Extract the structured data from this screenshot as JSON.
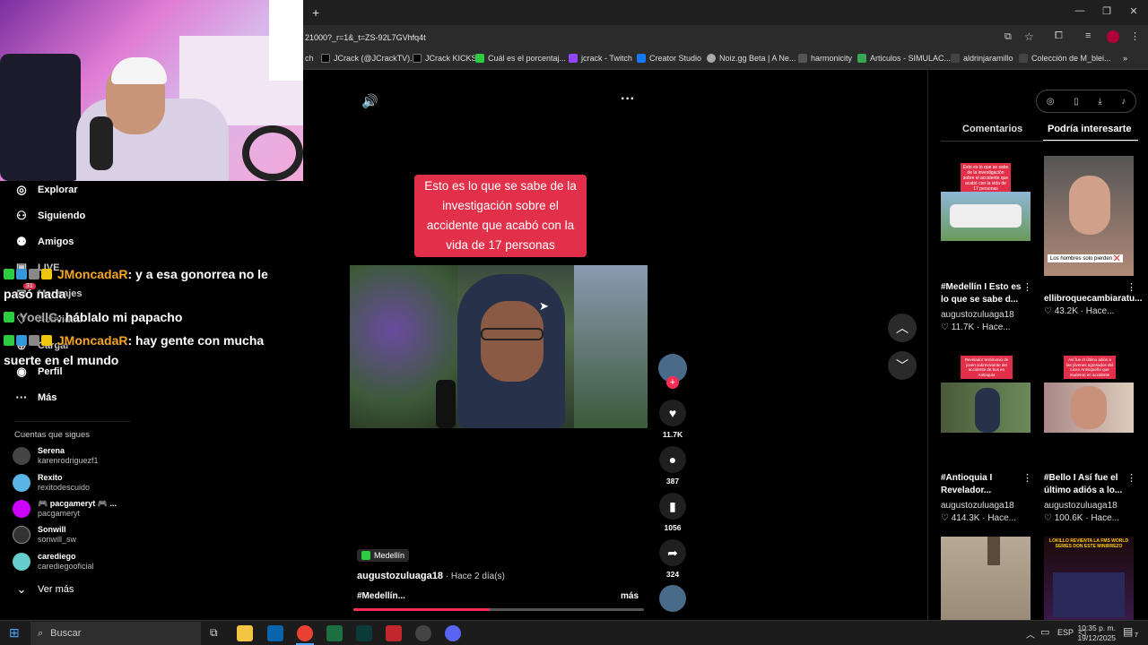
{
  "browser": {
    "new_tab": "+",
    "url": "21000?_r=1&_t=ZS-92L7GVhfq4t",
    "bookmarks": [
      {
        "label": "ch",
        "color": "#888"
      },
      {
        "label": "JCrack (@JCrackTV)...",
        "color": "#000"
      },
      {
        "label": "JCrack KICKS",
        "color": "#000"
      },
      {
        "label": "Cuál es el porcentaj...",
        "color": "#2ecc40"
      },
      {
        "label": "jcrack - Twitch",
        "color": "#9146ff"
      },
      {
        "label": "Creator Studio",
        "color": "#1877f2"
      },
      {
        "label": "Noiz.gg Beta | A Ne...",
        "color": "#aaa"
      },
      {
        "label": "harmonicity",
        "color": "#555"
      },
      {
        "label": "Articulos - SIMULAC...",
        "color": "#34a853"
      },
      {
        "label": "aldrinjaramillo",
        "color": "#444"
      },
      {
        "label": "Colección de M_blei...",
        "color": "#444"
      }
    ],
    "more_bookmarks": "»"
  },
  "sidebar": {
    "nav": [
      {
        "label": "Explorar",
        "icon": "compass-icon",
        "glyph": "◎"
      },
      {
        "label": "Siguiendo",
        "icon": "following-icon",
        "glyph": "⚇"
      },
      {
        "label": "Amigos",
        "icon": "friends-icon",
        "glyph": "⚉"
      },
      {
        "label": "LIVE",
        "icon": "live-icon",
        "glyph": "▣"
      },
      {
        "label": "Mensajes",
        "icon": "messages-icon",
        "glyph": "✉"
      },
      {
        "label": "Actividad",
        "icon": "activity-icon",
        "glyph": "♡"
      },
      {
        "label": "Cargar",
        "icon": "upload-icon",
        "glyph": "⊕"
      },
      {
        "label": "Perfil",
        "icon": "profile-icon",
        "glyph": "◉"
      },
      {
        "label": "Más",
        "icon": "more-icon",
        "glyph": "···"
      }
    ],
    "messages_badge": "31",
    "following_title": "Cuentas que sigues",
    "accounts": [
      {
        "name": "Serena",
        "handle": "karenrodriguezf1",
        "color": "#444"
      },
      {
        "name": "Rexito",
        "handle": "rexitodescuido",
        "color": "#5ab4e5"
      },
      {
        "name": "🎮 pacgameryt 🎮 ...",
        "handle": "pacgameryt",
        "color": "#c0f"
      },
      {
        "name": "Sonwill",
        "handle": "sonwill_sw",
        "color": "#333"
      },
      {
        "name": "carediego",
        "handle": "carediegooficial",
        "color": "#6cc"
      }
    ],
    "see_more": "Ver más"
  },
  "chat": [
    {
      "user": "JMoncadaR",
      "text": ": y a esa gonorrea no le pasó nada"
    },
    {
      "user": "YoellC",
      "text": ": háblalo mi papacho"
    },
    {
      "user": "JMoncadaR",
      "text": ": hay gente con mucha suerte en el mundo"
    }
  ],
  "player": {
    "overlay_text": "Esto es lo que se sabe de la investigación sobre el accidente que acabó con la vida de 17 personas",
    "likes": "11.7K",
    "comments": "387",
    "saves": "1056",
    "shares": "324",
    "location_tag": "Medellín",
    "author": "augustozuluaga18",
    "time": "Hace 2 día(s)",
    "caption": "#Medellín...",
    "more": "más",
    "progress": 0.47
  },
  "right_panel": {
    "tabs": [
      "Comentarios",
      "Podría interesarte"
    ],
    "active_tab": 1,
    "cards": [
      {
        "title": "#Medellín I Esto es lo que se sabe d...",
        "author": "augustozuluaga18",
        "stats": "11.7K · Hace...",
        "thumb_text": "Esto es lo que se sabe de la investigación sobre el accidente que acabó con la vida de 17 personas"
      },
      {
        "title": "ellibroquecambiaratu...",
        "author": "",
        "stats": "43.2K · Hace...",
        "thumb_text": "Los hombres solo pierden ❌"
      },
      {
        "title": "#Antioquia I Revelador...",
        "author": "augustozuluaga18",
        "stats": "414.3K · Hace...",
        "thumb_text": "Revelador testimonio de joven sobreviviente del accidente de bus en Antioquia"
      },
      {
        "title": "#Bello I Así fue el último adiós a lo...",
        "author": "augustozuluaga18",
        "stats": "100.6K · Hace...",
        "thumb_text": "Así fue el último adiós a las jóvenes egresados del Liceo Antioqueño que murieron en accidente"
      },
      {
        "title": "",
        "author": "",
        "stats": "",
        "thumb_text": ""
      },
      {
        "title": "",
        "author": "",
        "stats": "",
        "thumb_text": "LOKILLO REVIENTA LA FMS WORLD SERIES DON ESTE MINIRREZO"
      }
    ]
  },
  "taskbar": {
    "search_placeholder": "Buscar",
    "lang": "ESP",
    "time": "10:35 p. m.",
    "date": "19/12/2025",
    "notif": "7"
  }
}
